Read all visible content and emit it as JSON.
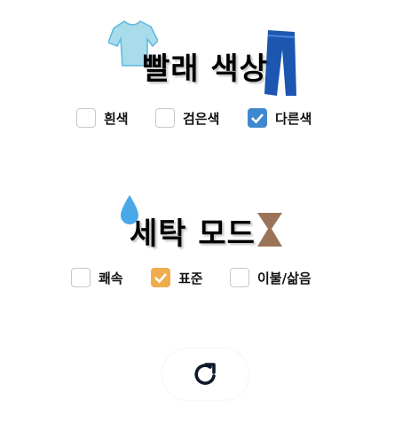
{
  "laundry_color": {
    "title": "빨래 색상",
    "options": [
      {
        "label": "흰색",
        "checked": false
      },
      {
        "label": "검은색",
        "checked": false
      },
      {
        "label": "다른색",
        "checked": true
      }
    ],
    "check_color": "#3f88cf"
  },
  "wash_mode": {
    "title": "세탁 모드",
    "options": [
      {
        "label": "쾌속",
        "checked": false
      },
      {
        "label": "표준",
        "checked": true
      },
      {
        "label": "이불/삶음",
        "checked": false
      }
    ],
    "check_color": "#f0ad4e"
  },
  "refresh_button": {
    "icon": "refresh-icon"
  }
}
